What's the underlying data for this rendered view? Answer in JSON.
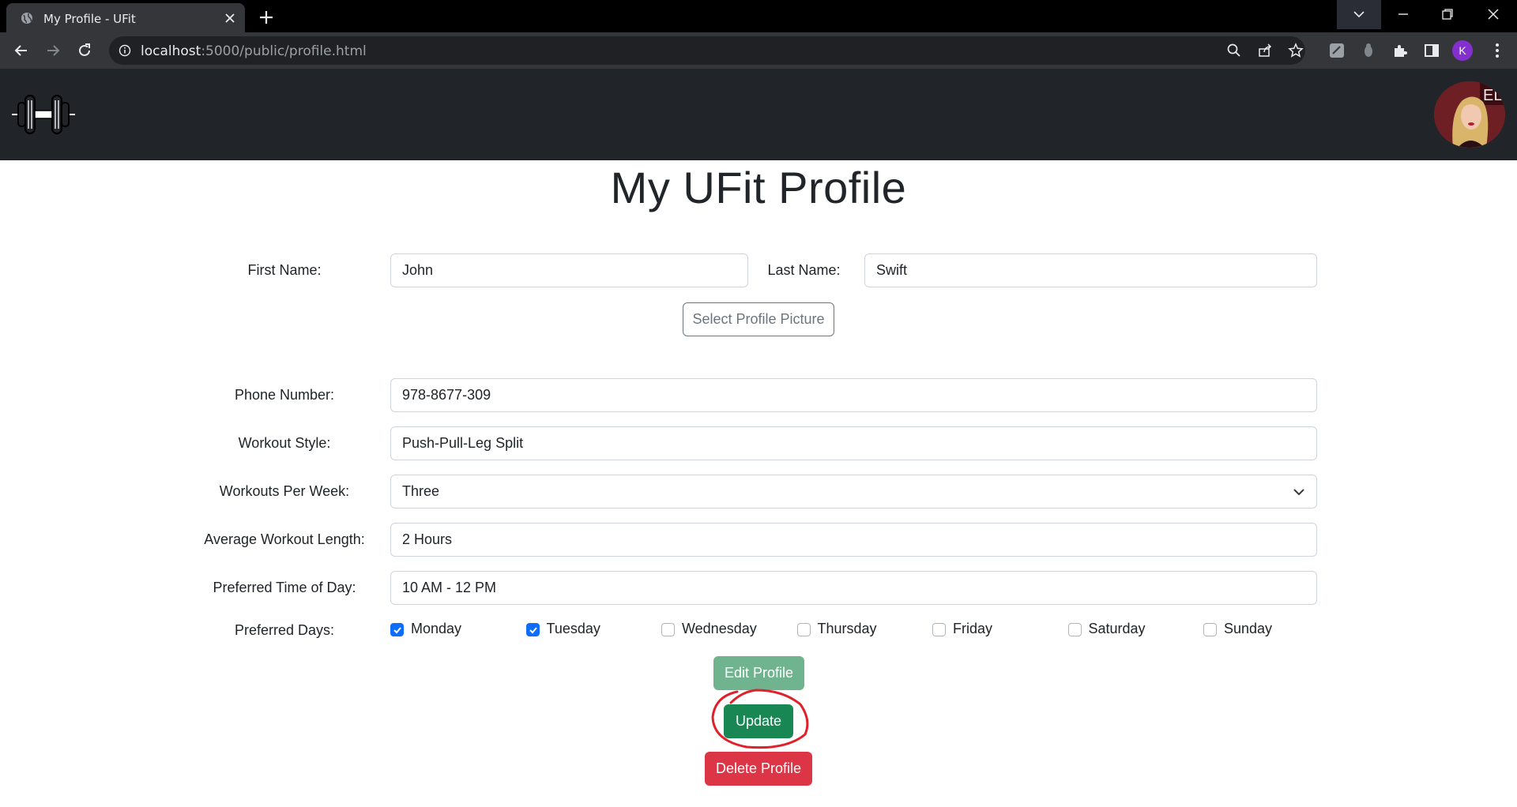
{
  "browser": {
    "tab_title": "My Profile - UFit",
    "url_host": "localhost",
    "url_rest": ":5000/public/profile.html",
    "profile_initial": "K"
  },
  "page": {
    "title": "My UFit Profile"
  },
  "form": {
    "first_name_label": "First Name:",
    "first_name_value": "John",
    "last_name_label": "Last Name:",
    "last_name_value": "Swift",
    "select_picture_label": "Select Profile Picture",
    "phone_label": "Phone Number:",
    "phone_value": "978-8677-309",
    "workout_style_label": "Workout Style:",
    "workout_style_value": "Push-Pull-Leg Split",
    "workouts_per_week_label": "Workouts Per Week:",
    "workouts_per_week_value": "Three",
    "avg_length_label": "Average Workout Length:",
    "avg_length_value": "2 Hours",
    "preferred_time_label": "Preferred Time of Day:",
    "preferred_time_value": "10 AM - 12 PM",
    "preferred_days_label": "Preferred Days:",
    "days": [
      {
        "label": "Monday",
        "checked": true
      },
      {
        "label": "Tuesday",
        "checked": true
      },
      {
        "label": "Wednesday",
        "checked": false
      },
      {
        "label": "Thursday",
        "checked": false
      },
      {
        "label": "Friday",
        "checked": false
      },
      {
        "label": "Saturday",
        "checked": false
      },
      {
        "label": "Sunday",
        "checked": false
      }
    ]
  },
  "actions": {
    "edit_label": "Edit Profile",
    "update_label": "Update",
    "delete_label": "Delete Profile"
  },
  "colors": {
    "navbar": "#212529",
    "primary": "#0d6efd",
    "success": "#198754",
    "success_faded": "#6fb38f",
    "danger": "#dc3545",
    "annotation": "#e0202a"
  }
}
